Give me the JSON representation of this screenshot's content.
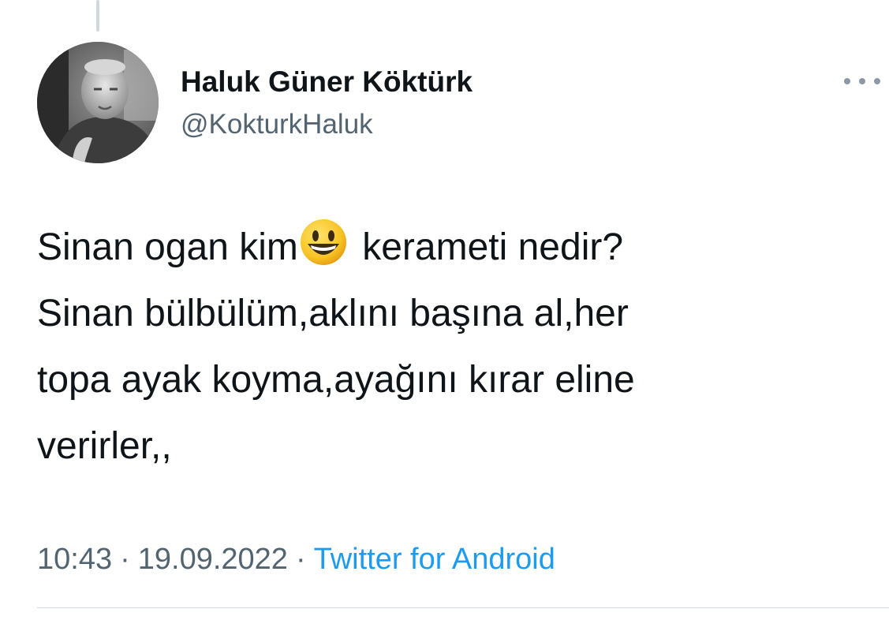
{
  "author": {
    "display_name": "Haluk Güner Köktürk",
    "handle": "@KokturkHaluk",
    "avatar_icon": "profile-photo"
  },
  "more_icon": "more-dots-icon",
  "tweet": {
    "line1_before": "Sinan ogan kim",
    "line1_emoji": "grinning-face-emoji",
    "line1_after": " kerameti nedir?",
    "line2": "Sinan bülbülüm,aklını başına al,her",
    "line3": "topa ayak koyma,ayağını kırar eline",
    "line4": "verirler,,"
  },
  "meta": {
    "time": "10:43",
    "separator": "·",
    "date": "19.09.2022",
    "source": "Twitter for Android"
  },
  "colors": {
    "text": "#0f1419",
    "secondary": "#536471",
    "link": "#1d9bf0",
    "divider": "#cfd9de"
  }
}
